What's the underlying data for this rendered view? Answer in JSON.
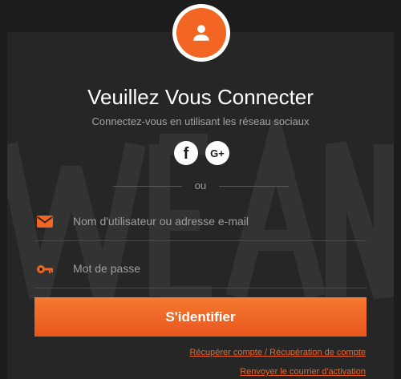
{
  "header": {
    "title": "Veuillez Vous Connecter",
    "subtitle": "Connectez-vous en utilisant les réseau sociaux",
    "avatar_icon": "user-icon"
  },
  "social": {
    "facebook_icon": "facebook-icon",
    "google_icon": "google-plus-icon",
    "facebook_glyph": "f",
    "google_glyph": "G+"
  },
  "divider": {
    "text": "ou"
  },
  "form": {
    "username_placeholder": "Nom d'utilisateur ou adresse e-mail",
    "username_icon": "envelope-icon",
    "password_placeholder": "Mot de passe",
    "password_icon": "key-icon",
    "submit_label": "S'identifier"
  },
  "links": {
    "recover": "Récupérer compte / Récupération de compte",
    "resend": "Renvoyer le courrier d'activation"
  },
  "colors": {
    "accent": "#f26522",
    "background": "#1c1c1c",
    "panel": "#262626"
  }
}
